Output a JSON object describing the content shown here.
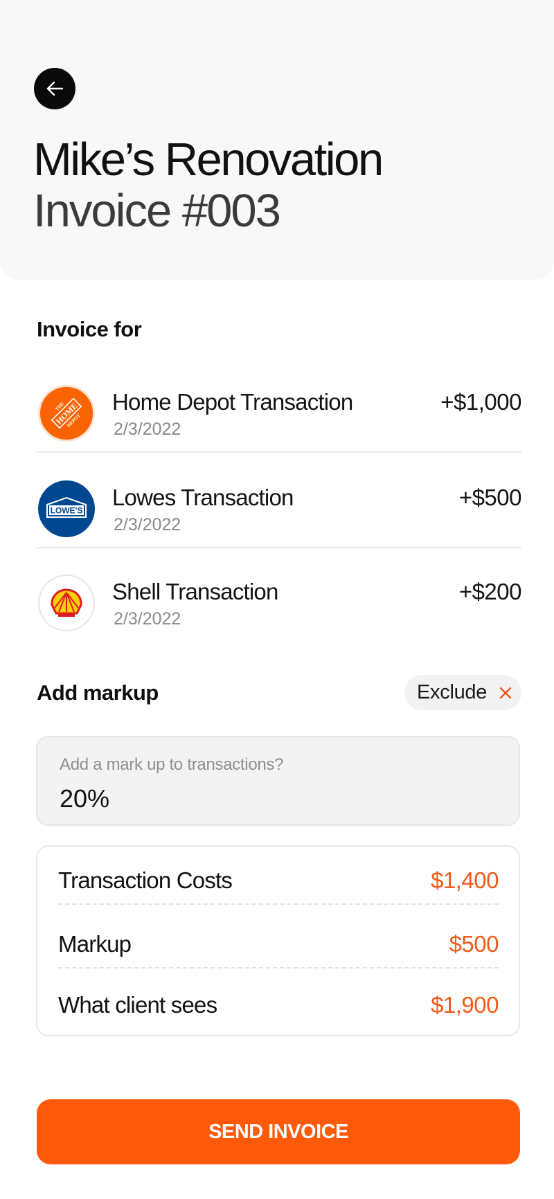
{
  "header": {
    "back_icon": "arrow-left-icon",
    "title": "Mike’s Renovation",
    "subtitle": "Invoice #003"
  },
  "invoice_for": {
    "heading": "Invoice for",
    "transactions": [
      {
        "name": "Home Depot Transaction",
        "date": "2/3/2022",
        "amount": "+$1,000",
        "logo": "home-depot-logo",
        "logo_text": "THE HOME DEPOT",
        "logo_color": "#f96302"
      },
      {
        "name": "Lowes Transaction",
        "date": "2/3/2022",
        "amount": "+$500",
        "logo": "lowes-logo",
        "logo_text": "LOWE'S",
        "logo_color": "#004990"
      },
      {
        "name": "Shell Transaction",
        "date": "2/3/2022",
        "amount": "+$200",
        "logo": "shell-logo",
        "logo_color": "#fbce07"
      }
    ]
  },
  "markup": {
    "heading": "Add markup",
    "exclude_label": "Exclude",
    "exclude_icon": "close-icon",
    "input_placeholder": "Add a mark up to transactions?",
    "input_value": "20%"
  },
  "summary": {
    "rows": [
      {
        "label": "Transaction Costs",
        "value": "$1,400"
      },
      {
        "label": "Markup",
        "value": "$500"
      },
      {
        "label": "What client sees",
        "value": "$1,900"
      }
    ]
  },
  "actions": {
    "send_label": "SEND INVOICE"
  },
  "colors": {
    "accent": "#ff5a0a",
    "accent_text": "#f05a1a",
    "header_bg": "#f8f8f8"
  }
}
